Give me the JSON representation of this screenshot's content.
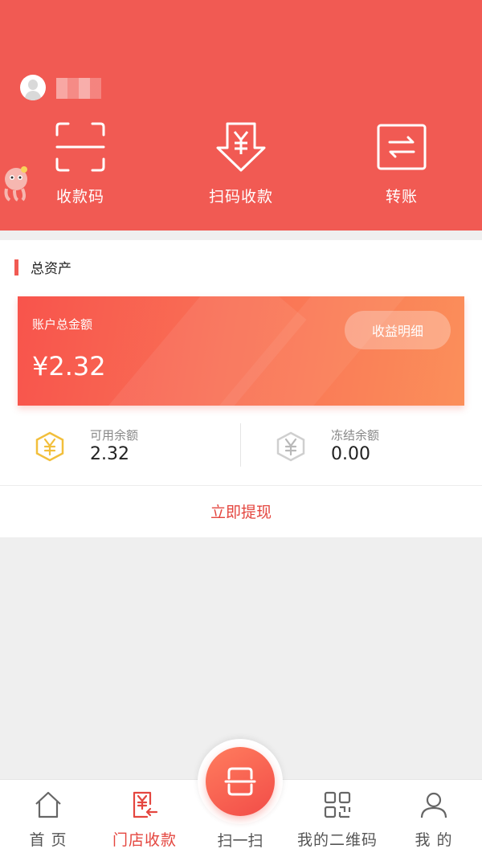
{
  "header": {
    "actions": [
      {
        "label": "收款码",
        "icon": "qr-frame-icon"
      },
      {
        "label": "扫码收款",
        "icon": "scan-receive-icon"
      },
      {
        "label": "转账",
        "icon": "transfer-icon"
      }
    ]
  },
  "assets": {
    "section_title": "总资产",
    "card_label": "账户总金额",
    "total_amount": "¥2.32",
    "income_button": "收益明细",
    "available_label": "可用余额",
    "available_value": "2.32",
    "frozen_label": "冻结余额",
    "frozen_value": "0.00",
    "withdraw_label": "立即提现"
  },
  "tabbar": {
    "home": "首 页",
    "store": "门店收款",
    "scan": "扫一扫",
    "qrcode": "我的二维码",
    "mine": "我 的"
  },
  "colors": {
    "brand": "#f15a53",
    "accent_text": "#e4463f",
    "gold": "#f2bf3c"
  }
}
